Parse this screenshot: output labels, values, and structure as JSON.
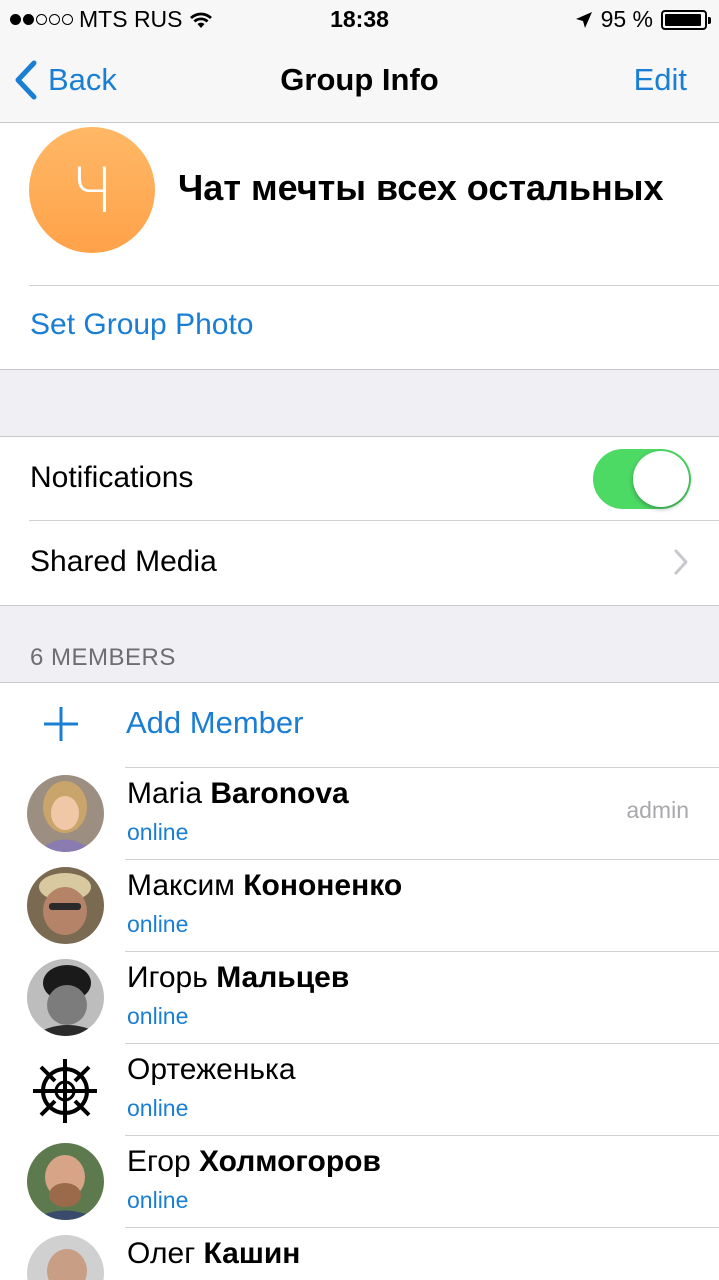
{
  "status_bar": {
    "carrier": "MTS RUS",
    "time": "18:38",
    "battery_percent": "95 %",
    "battery_level": 0.95,
    "signal_bars_filled": 2,
    "signal_bars_total": 5
  },
  "nav": {
    "back_label": "Back",
    "title": "Group Info",
    "edit_label": "Edit"
  },
  "group": {
    "avatar_letter": "Ч",
    "avatar_color": "#ffb866",
    "name": "Чат мечты всех остальных",
    "set_photo_label": "Set Group Photo"
  },
  "settings": {
    "notifications_label": "Notifications",
    "notifications_on": true,
    "shared_media_label": "Shared Media"
  },
  "members": {
    "header": "6 MEMBERS",
    "add_label": "Add Member",
    "list": [
      {
        "first": "Maria",
        "last": "Baronova",
        "status": "online",
        "role": "admin",
        "avatar": "avatar-photo"
      },
      {
        "first": "Максим",
        "last": "Кононенко",
        "status": "online",
        "role": "",
        "avatar": "avatar-photo"
      },
      {
        "first": "Игорь",
        "last": "Мальцев",
        "status": "online",
        "role": "",
        "avatar": "avatar-photo"
      },
      {
        "first": "Ортеженька",
        "last": "",
        "status": "online",
        "role": "",
        "avatar": "emblem-avatar"
      },
      {
        "first": "Егор",
        "last": "Холмогоров",
        "status": "online",
        "role": "",
        "avatar": "avatar-photo"
      },
      {
        "first": "Олег",
        "last": "Кашин",
        "status": "",
        "role": "",
        "avatar": "avatar-photo"
      }
    ]
  },
  "colors": {
    "accent": "#1a7fd4",
    "toggle_on": "#4cd964",
    "section_bg": "#efeff4"
  }
}
